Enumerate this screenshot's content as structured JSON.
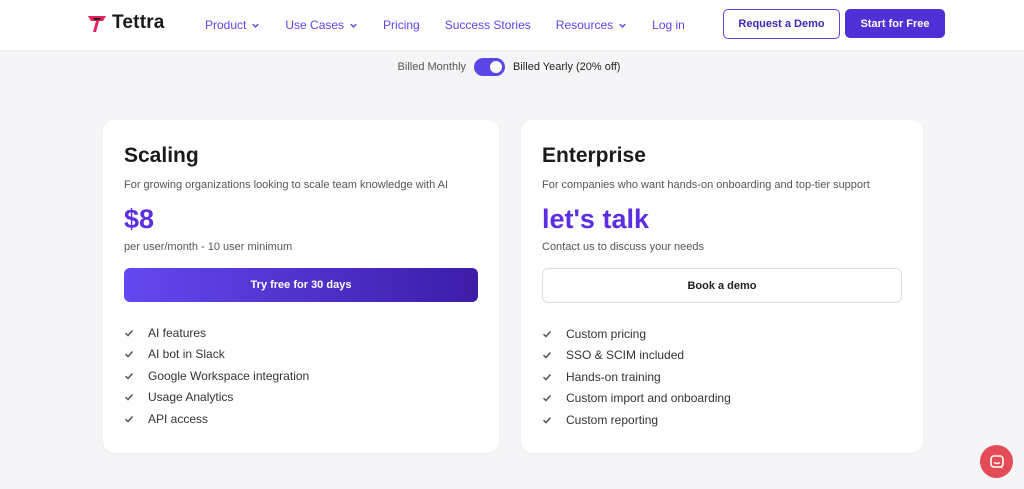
{
  "brand": {
    "name": "Tettra",
    "accent": "#5b46e8",
    "logo_color": "#e0245e"
  },
  "nav": {
    "items": [
      {
        "label": "Product",
        "dropdown": true
      },
      {
        "label": "Use Cases",
        "dropdown": true
      },
      {
        "label": "Pricing",
        "dropdown": false
      },
      {
        "label": "Success Stories",
        "dropdown": false
      },
      {
        "label": "Resources",
        "dropdown": true
      },
      {
        "label": "Log in",
        "dropdown": false
      }
    ],
    "request_demo": "Request a Demo",
    "start_free": "Start for Free"
  },
  "billing": {
    "monthly_label": "Billed Monthly",
    "yearly_label": "Billed Yearly (20% off)",
    "yearly_selected": true
  },
  "plans": [
    {
      "title": "Scaling",
      "description": "For growing organizations looking to scale team knowledge with AI",
      "price": "$8",
      "price_note": "per user/month - 10 user minimum",
      "cta": "Try free for 30 days",
      "features": [
        "AI features",
        "AI bot in Slack",
        "Google Workspace integration",
        "Usage Analytics",
        "API access"
      ]
    },
    {
      "title": "Enterprise",
      "description": "For companies who want hands-on onboarding and top-tier support",
      "price": "let's talk",
      "price_note": "Contact us to discuss your needs",
      "cta": "Book a demo",
      "features": [
        "Custom pricing",
        "SSO & SCIM included",
        "Hands-on training",
        "Custom import and onboarding",
        "Custom reporting"
      ]
    }
  ],
  "icons": {
    "check": "check-icon",
    "chevron": "chevron-down-icon",
    "chat": "chat-icon"
  }
}
